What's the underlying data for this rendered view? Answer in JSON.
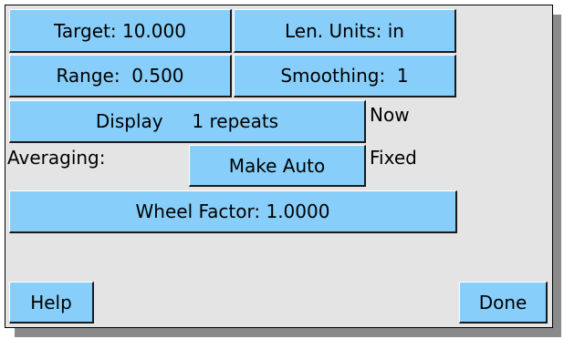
{
  "colors": {
    "panel_background": "#e4e4e4",
    "button_face": "#87cefa",
    "shadow": "#8a8a8a"
  },
  "buttons": {
    "target": "Target: 10.000",
    "len_units": "Len. Units: in",
    "range": "Range:  0.500",
    "smoothing": "Smoothing:  1",
    "display": "Display     1 repeats",
    "make_auto": "Make Auto",
    "wheel_factor": "Wheel Factor: 1.0000",
    "help": "Help",
    "done": "Done"
  },
  "labels": {
    "now": "Now",
    "averaging": "Averaging:",
    "fixed": "Fixed"
  }
}
